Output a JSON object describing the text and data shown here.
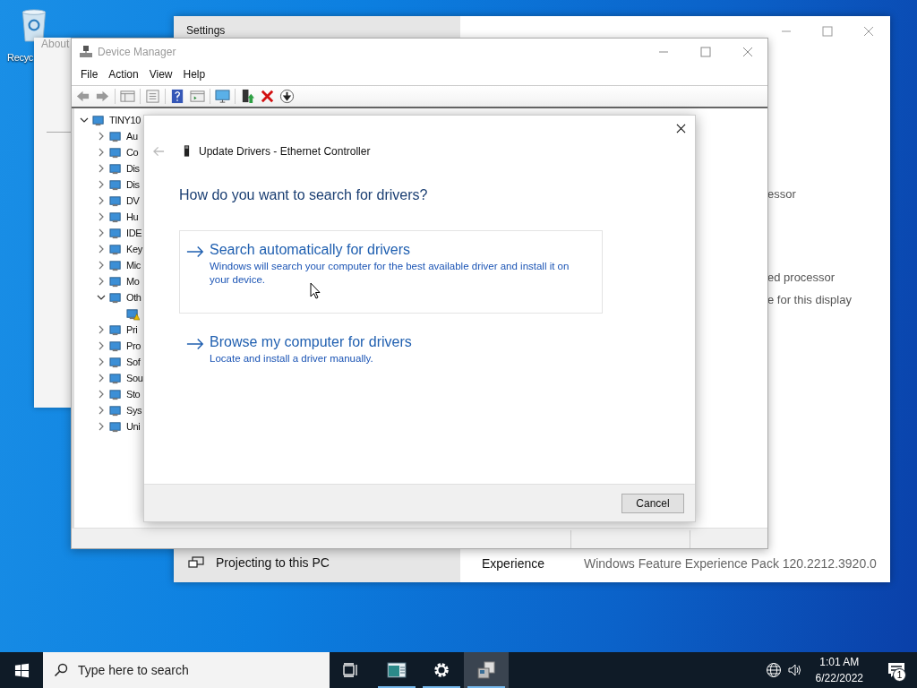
{
  "desktop": {
    "icons": [
      {
        "label": "Recyc"
      }
    ]
  },
  "about_window": {
    "title": "About"
  },
  "settings": {
    "title": "Settings",
    "fragments": [
      "essor",
      "ed processor",
      "e for this display"
    ],
    "nav_item": {
      "label": "Projecting to this PC"
    },
    "spec": {
      "label": "Experience",
      "value": "Windows Feature Experience Pack 120.2212.3920.0"
    }
  },
  "device_manager": {
    "title": "Device Manager",
    "menu": [
      "File",
      "Action",
      "View",
      "Help"
    ],
    "tree": [
      {
        "label": "TINY10",
        "expanded": true,
        "children": [
          {
            "label": "Au",
            "expanded": false
          },
          {
            "label": "Co",
            "expanded": false
          },
          {
            "label": "Dis",
            "expanded": false
          },
          {
            "label": "Dis",
            "expanded": false
          },
          {
            "label": "DV",
            "expanded": false
          },
          {
            "label": "Hu",
            "expanded": false
          },
          {
            "label": "IDE",
            "expanded": false
          },
          {
            "label": "Key",
            "expanded": false
          },
          {
            "label": "Mic",
            "expanded": false
          },
          {
            "label": "Mo",
            "expanded": false
          },
          {
            "label": "Oth",
            "expanded": true,
            "children": [
              {
                "warning": true
              }
            ]
          },
          {
            "label": "Pri",
            "expanded": false
          },
          {
            "label": "Pro",
            "expanded": false
          },
          {
            "label": "Sof",
            "expanded": false
          },
          {
            "label": "Sou",
            "expanded": false
          },
          {
            "label": "Sto",
            "expanded": false
          },
          {
            "label": "Sys",
            "expanded": false
          },
          {
            "label": "Uni",
            "expanded": false
          }
        ]
      }
    ]
  },
  "dialog": {
    "title": "Update Drivers - Ethernet Controller",
    "back_disabled": true,
    "heading": "How do you want to search for drivers?",
    "options": [
      {
        "title": "Search automatically for drivers",
        "description": "Windows will search your computer for the best available driver and install it on your device.",
        "selected": true
      },
      {
        "title": "Browse my computer for drivers",
        "description": "Locate and install a driver manually.",
        "selected": false
      }
    ],
    "buttons": [
      "Cancel"
    ]
  },
  "taskbar": {
    "search": {
      "placeholder": "Type here to search"
    },
    "apps": [
      {
        "kind": "window",
        "selected": false
      },
      {
        "kind": "gear",
        "selected": false
      },
      {
        "kind": "device",
        "selected": true
      }
    ],
    "time": "1:01 AM",
    "date": "6/22/2022",
    "notifications": "1"
  }
}
